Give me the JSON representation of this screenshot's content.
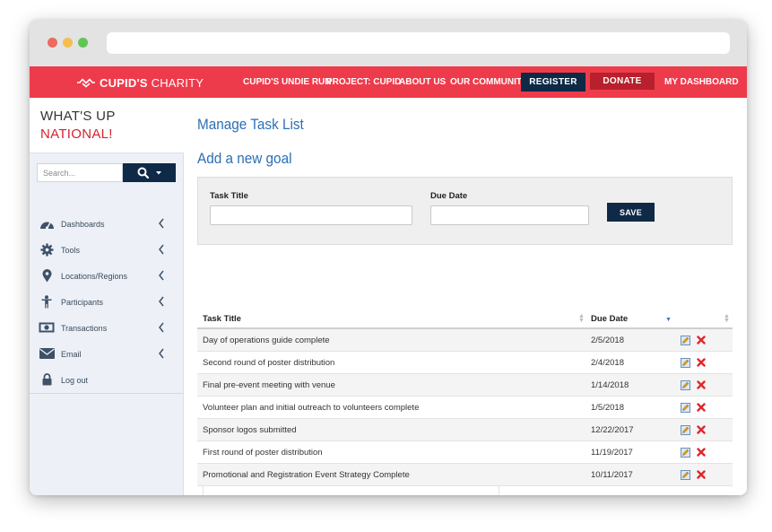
{
  "brand": {
    "logo_bold": "CUPID'S",
    "logo_light": "CHARITY"
  },
  "nav": {
    "links": [
      "CUPID'S UNDIE RUN",
      "PROJECT: CUPID",
      "ABOUT US",
      "OUR COMMUNITY"
    ],
    "register": "REGISTER",
    "donate": "DONATE",
    "dashboard": "MY DASHBOARD"
  },
  "sidebar": {
    "greeting_line1": "WHAT'S UP",
    "greeting_line2": "NATIONAL!",
    "search_placeholder": "Search...",
    "items": [
      {
        "label": "Dashboards",
        "icon": "dashboard-icon",
        "has_chevron": true
      },
      {
        "label": "Tools",
        "icon": "gear-icon",
        "has_chevron": true
      },
      {
        "label": "Locations/Regions",
        "icon": "map-pin-icon",
        "has_chevron": true
      },
      {
        "label": "Participants",
        "icon": "person-icon",
        "has_chevron": true
      },
      {
        "label": "Transactions",
        "icon": "money-icon",
        "has_chevron": true
      },
      {
        "label": "Email",
        "icon": "envelope-icon",
        "has_chevron": true
      },
      {
        "label": "Log out",
        "icon": "lock-icon",
        "has_chevron": false
      }
    ]
  },
  "main": {
    "title": "Manage Task List",
    "subtitle": "Add a new goal",
    "form": {
      "task_title_label": "Task Title",
      "task_title_value": "",
      "due_date_label": "Due Date",
      "due_date_value": "",
      "save_label": "SAVE"
    },
    "table": {
      "headers": [
        "Task Title",
        "Due Date"
      ],
      "rows": [
        {
          "title": "Day of operations guide complete",
          "due": "2/5/2018"
        },
        {
          "title": "Second round of poster distribution",
          "due": "2/4/2018"
        },
        {
          "title": "Final pre-event meeting with venue",
          "due": "1/14/2018"
        },
        {
          "title": "Volunteer plan and initial outreach to volunteers complete",
          "due": "1/5/2018"
        },
        {
          "title": "Sponsor logos submitted",
          "due": "12/22/2017"
        },
        {
          "title": "First round of poster distribution",
          "due": "11/19/2017"
        },
        {
          "title": "Promotional and Registration Event Strategy Complete",
          "due": "10/11/2017"
        }
      ]
    }
  },
  "colors": {
    "nav_red": "#ee3b4b",
    "navy": "#0e2a47",
    "donate_red": "#b8202d",
    "title_blue": "#2c6fb5",
    "greeting_red": "#d42231"
  }
}
